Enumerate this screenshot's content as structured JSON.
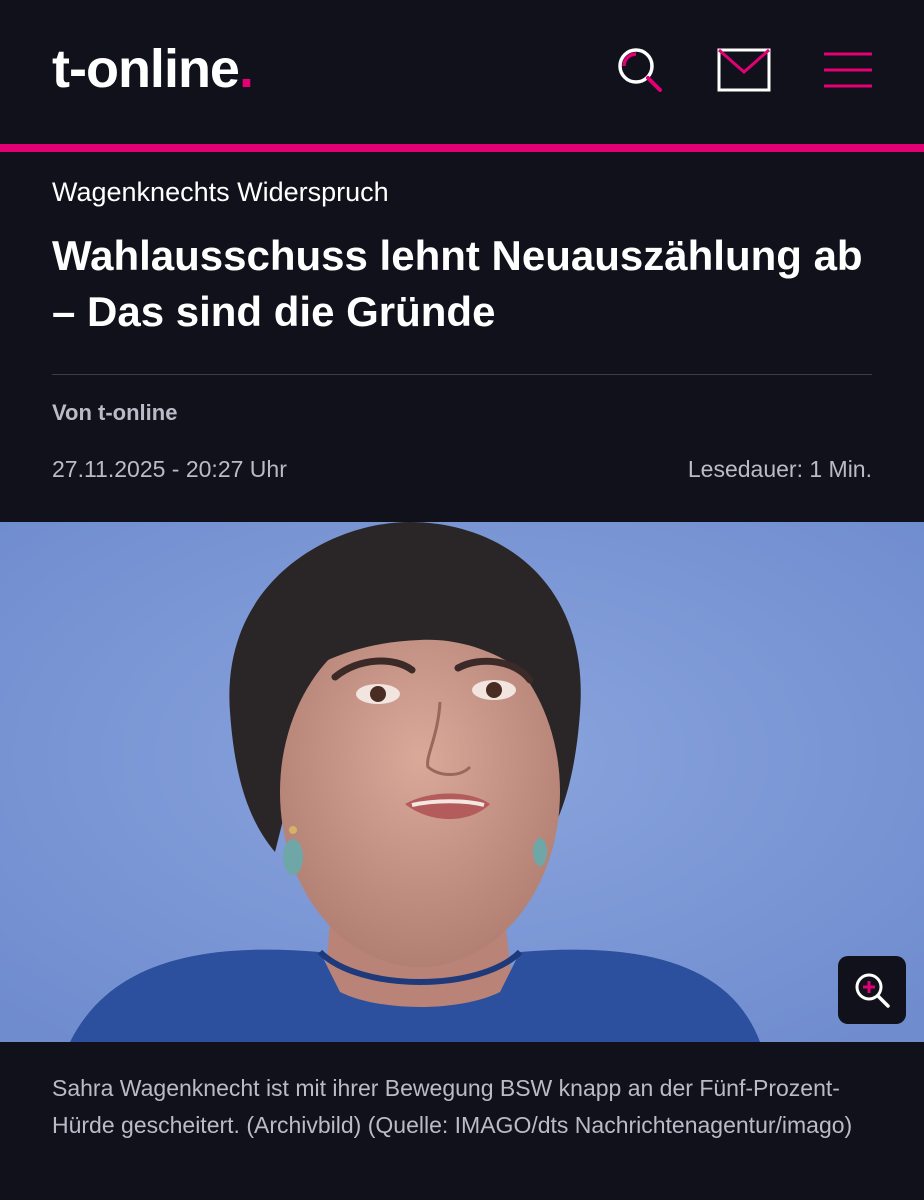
{
  "header": {
    "logo_text": "t-online",
    "logo_dot": ".",
    "accent_color": "#e20074",
    "icons": [
      "search-icon",
      "mail-icon",
      "menu-icon"
    ]
  },
  "article": {
    "kicker": "Wagenknechts Widerspruch",
    "headline": "Wahlausschuss lehnt Neuauszählung ab – Das sind die Gründe",
    "author": "Von t-online",
    "date": "27.11.2025 - 20:27 Uhr",
    "read_time": "Lesedauer: 1 Min."
  },
  "image": {
    "caption": "Sahra Wagenknecht ist mit ihrer Bewegung BSW knapp an der Fünf-Prozent-Hürde gescheitert. (Archivbild) (Quelle: IMAGO/dts Nachrichtenagentur/imago)",
    "zoom_icon": "zoom-in-icon"
  }
}
